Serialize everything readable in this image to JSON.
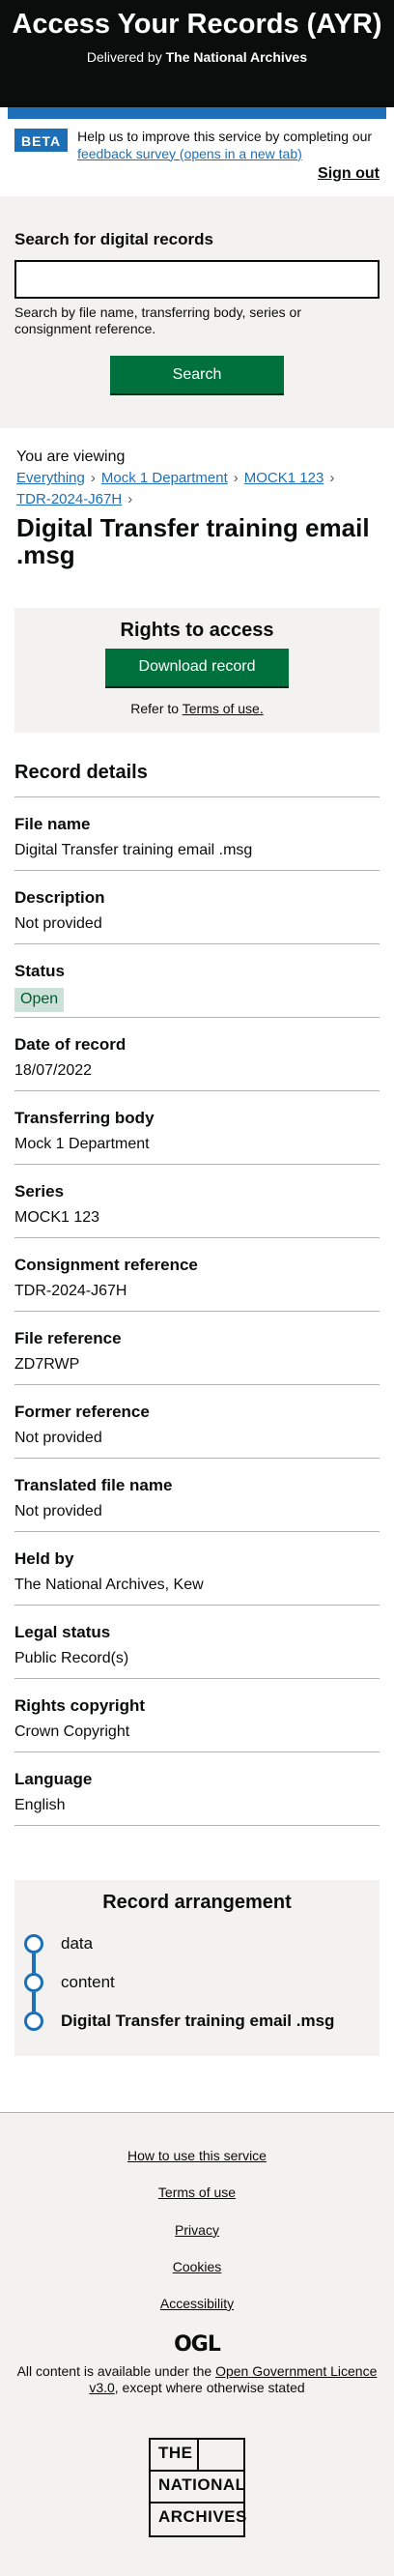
{
  "header": {
    "title": "Access Your Records (AYR)",
    "delivered_by": "Delivered by",
    "org": "The National Archives"
  },
  "banner": {
    "tag": "BETA",
    "text": "Help us to improve this service by completing our",
    "link": "feedback survey (opens in a new tab)",
    "sign_out": "Sign out"
  },
  "search": {
    "label": "Search for digital records",
    "value": "",
    "hint": "Search by file name, transferring body, series or consignment reference.",
    "button": "Search"
  },
  "viewing": {
    "intro": "You are viewing",
    "breadcrumbs": [
      "Everything",
      "Mock 1 Department",
      "MOCK1 123",
      "TDR-2024-J67H"
    ],
    "title": "Digital Transfer training email .msg"
  },
  "rights": {
    "heading": "Rights to access",
    "download": "Download record",
    "refer": "Refer to",
    "terms": "Terms of use."
  },
  "details": {
    "heading": "Record details",
    "fields": [
      {
        "label": "File name",
        "value": "Digital Transfer training email .msg"
      },
      {
        "label": "Description",
        "value": "Not provided"
      },
      {
        "label": "Status",
        "value": "Open"
      },
      {
        "label": "Date of record",
        "value": "18/07/2022"
      },
      {
        "label": "Transferring body",
        "value": "Mock 1 Department"
      },
      {
        "label": "Series",
        "value": "MOCK1 123"
      },
      {
        "label": "Consignment reference",
        "value": "TDR-2024-J67H"
      },
      {
        "label": "File reference",
        "value": "ZD7RWP"
      },
      {
        "label": "Former reference",
        "value": "Not provided"
      },
      {
        "label": "Translated file name",
        "value": "Not provided"
      },
      {
        "label": "Held by",
        "value": "The National Archives, Kew"
      },
      {
        "label": "Legal status",
        "value": "Public Record(s)"
      },
      {
        "label": "Rights copyright",
        "value": "Crown Copyright"
      },
      {
        "label": "Language",
        "value": "English"
      }
    ]
  },
  "arrangement": {
    "heading": "Record arrangement",
    "items": [
      "data",
      "content",
      "Digital Transfer training email .msg"
    ]
  },
  "footer": {
    "links": [
      "How to use this service",
      "Terms of use",
      "Privacy",
      "Cookies",
      "Accessibility"
    ],
    "ogl": "OGL",
    "licence_pre": "All content is available under the",
    "licence_link": "Open Government Licence v3.0",
    "licence_post": ", except where otherwise stated",
    "logo": [
      "THE",
      "NATIONAL",
      "ARCHIVES"
    ]
  },
  "colors": {
    "brand_blue": "#1d70b8",
    "button_green": "#00703c",
    "header_black": "#0b0c0c",
    "open_tag_bg": "#cce2d8"
  }
}
